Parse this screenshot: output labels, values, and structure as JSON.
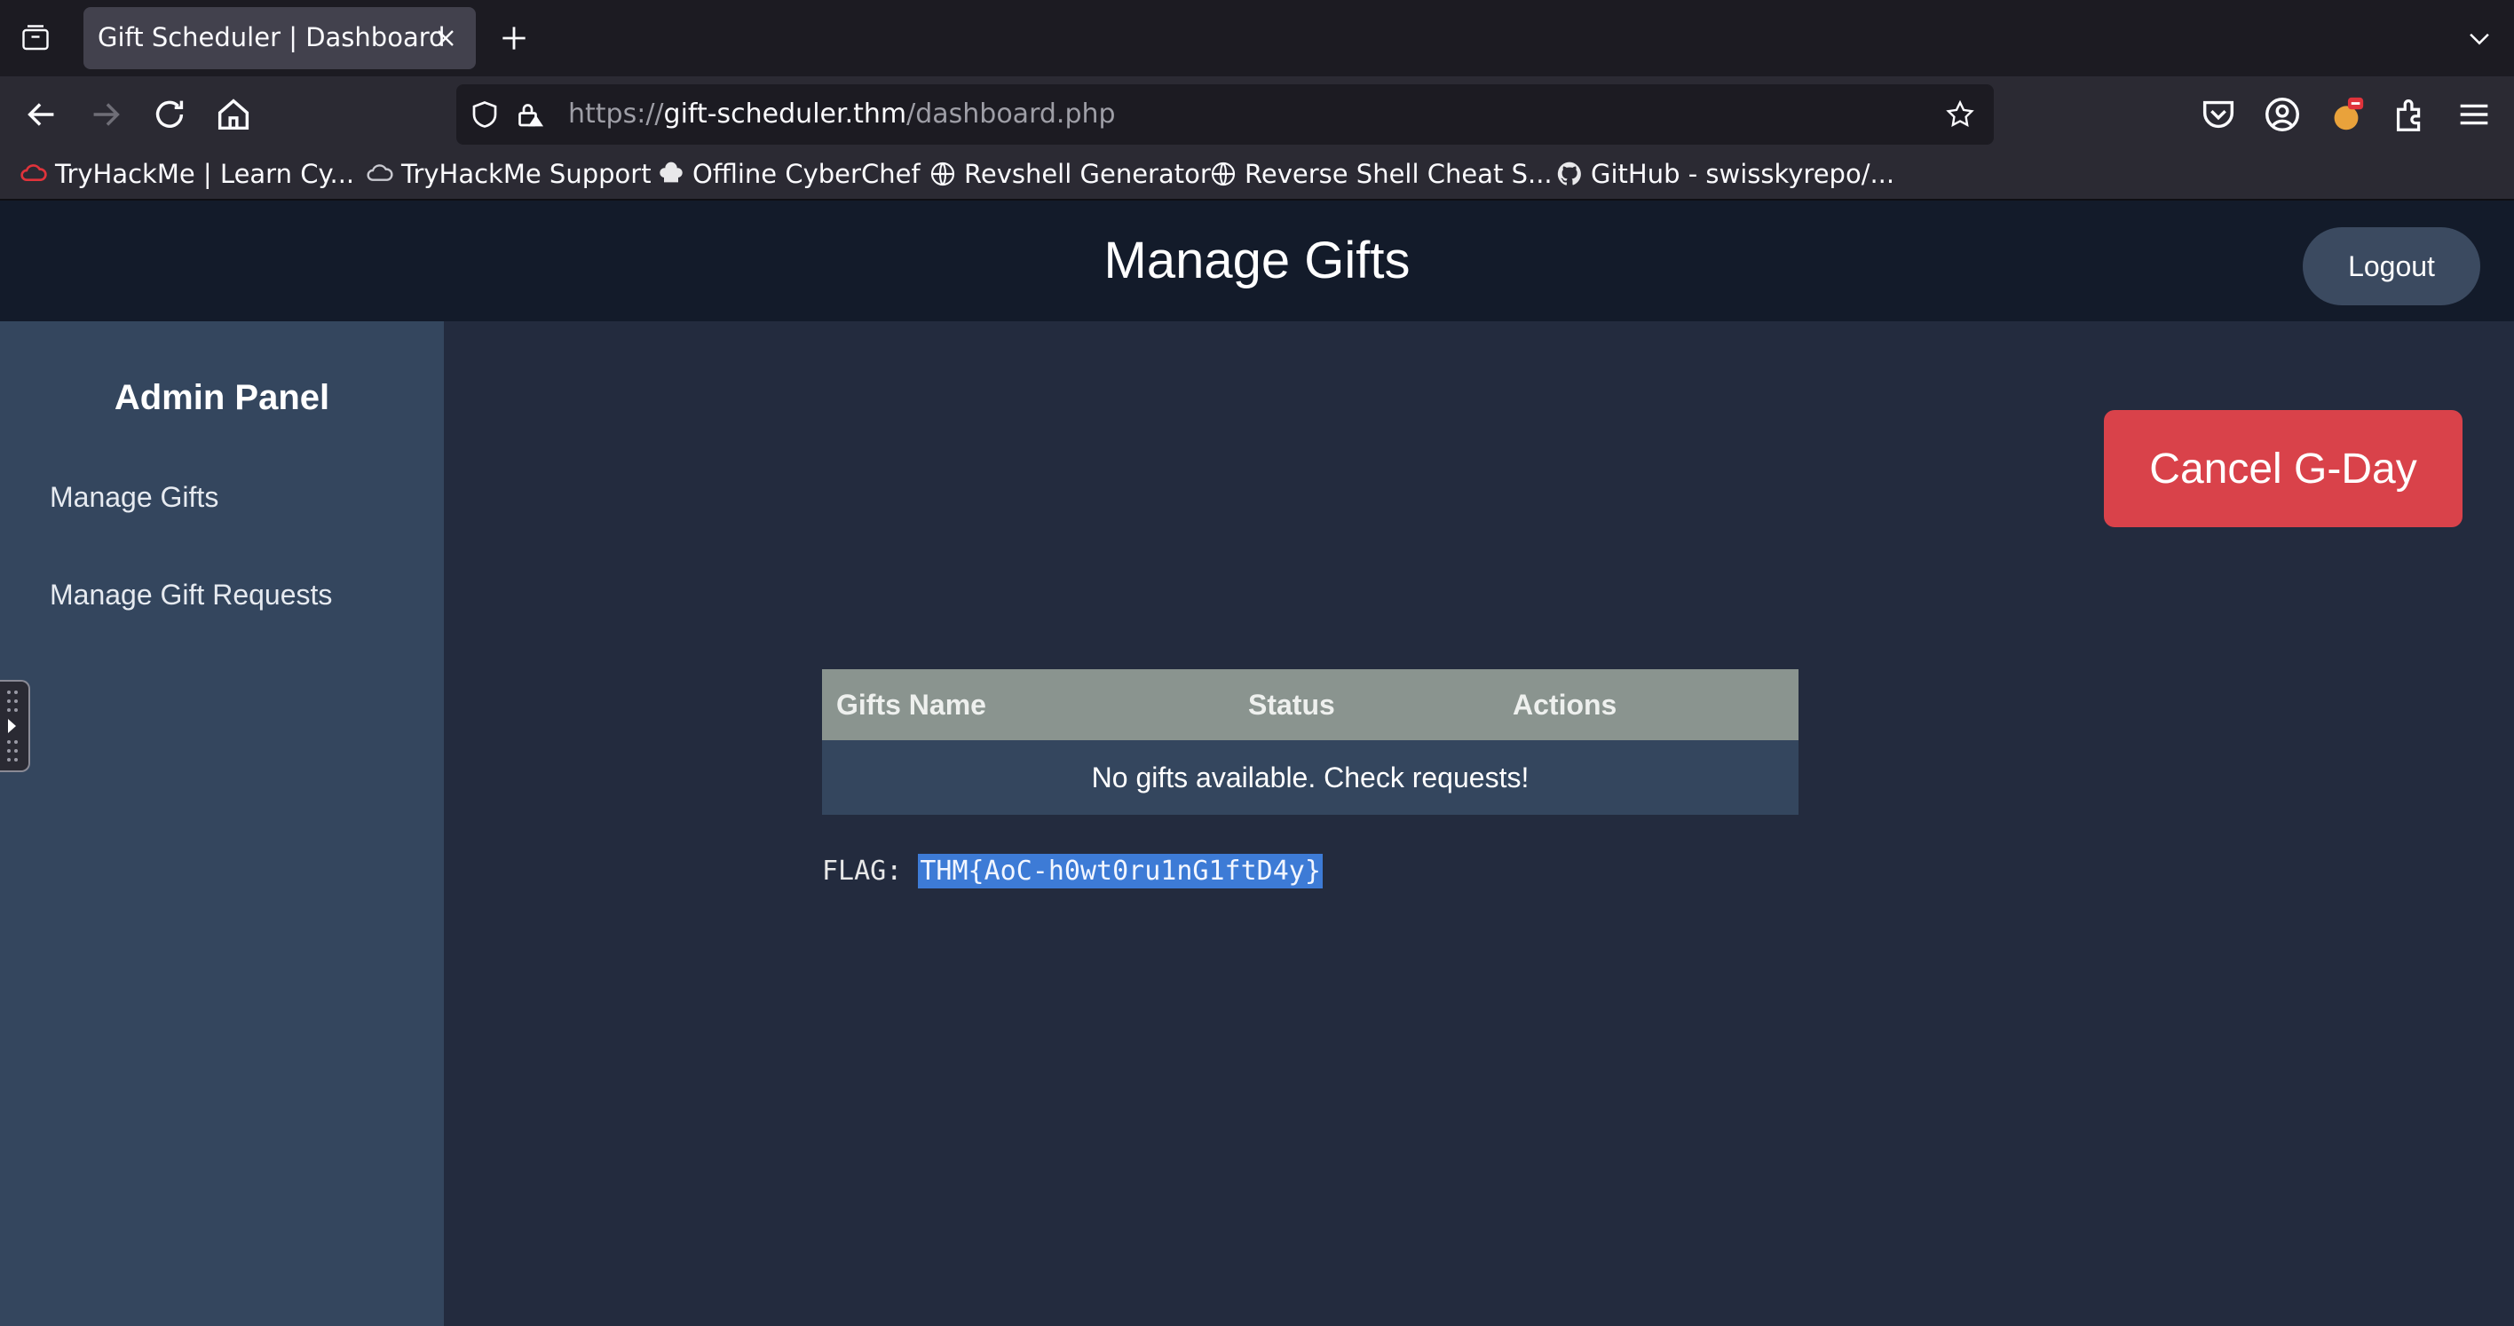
{
  "browser": {
    "tab_title": "Gift Scheduler | Dashboard",
    "url_scheme": "https://",
    "url_host": "gift-scheduler.thm",
    "url_path": "/dashboard.php",
    "bookmarks": [
      {
        "label": "TryHackMe | Learn Cy...",
        "icon": "tryhackme-icon"
      },
      {
        "label": "TryHackMe Support",
        "icon": "support-cloud-icon"
      },
      {
        "label": "Offline CyberChef",
        "icon": "chef-hat-icon"
      },
      {
        "label": "Revshell Generator",
        "icon": "globe-icon"
      },
      {
        "label": "Reverse Shell Cheat S...",
        "icon": "globe-icon"
      },
      {
        "label": "GitHub - swisskyrepo/...",
        "icon": "github-icon"
      }
    ]
  },
  "header": {
    "title": "Manage Gifts",
    "logout_label": "Logout"
  },
  "sidebar": {
    "title": "Admin Panel",
    "items": [
      {
        "label": "Manage Gifts"
      },
      {
        "label": "Manage Gift Requests"
      }
    ]
  },
  "main": {
    "cancel_label": "Cancel G-Day",
    "table": {
      "columns": [
        "Gifts Name",
        "Status",
        "Actions"
      ],
      "empty_message": "No gifts available. Check requests!"
    },
    "flag_label": "FLAG: ",
    "flag_value": "THM{AoC-h0wt0ru1nG1ftD4y}"
  },
  "colors": {
    "header_bg": "#131b2a",
    "sidebar_bg": "#34465e",
    "content_bg": "#232b3e",
    "cancel_button": "#d9424a",
    "table_header": "#8a948f",
    "selection": "#3d7bd6"
  }
}
